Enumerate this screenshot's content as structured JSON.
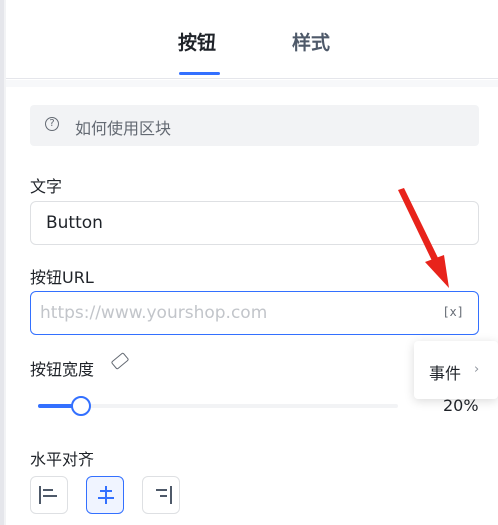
{
  "tabs": [
    {
      "label": "按钮",
      "active": true
    },
    {
      "label": "样式",
      "active": false
    }
  ],
  "help": {
    "icon": "question-circle-icon",
    "text": "如何使用区块"
  },
  "text_field": {
    "label": "文字",
    "value": "Button"
  },
  "url_field": {
    "label": "按钮URL",
    "placeholder": "https://www.yourshop.com",
    "var_button": "[x]"
  },
  "width": {
    "label": "按钮宽度",
    "icon": "eraser-icon",
    "value_label": "20%",
    "value_fraction": 0.12
  },
  "popup": {
    "label": "事件",
    "chevron": "›"
  },
  "align": {
    "label": "水平对齐",
    "selected": "center",
    "options": [
      "left",
      "center",
      "right"
    ]
  },
  "colors": {
    "accent": "#3370ff",
    "annotation": "#e8231b"
  }
}
